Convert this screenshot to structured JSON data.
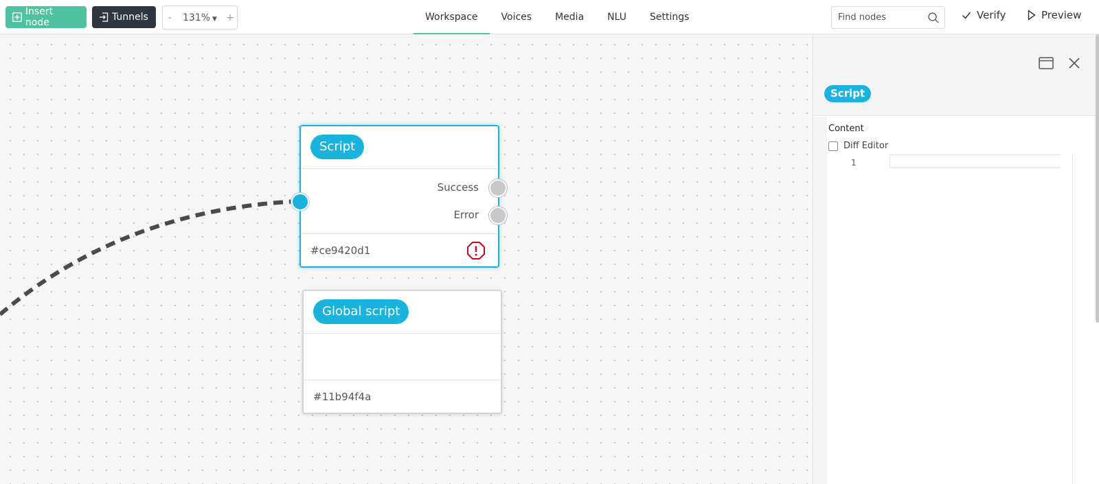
{
  "toolbar": {
    "insert_node_label": "Insert node",
    "tunnels_label": "Tunnels",
    "zoom": {
      "minus": "-",
      "value": "131%",
      "plus": "+"
    }
  },
  "nav": {
    "tabs": [
      {
        "label": "Workspace",
        "active": true
      },
      {
        "label": "Voices"
      },
      {
        "label": "Media"
      },
      {
        "label": "NLU"
      },
      {
        "label": "Settings"
      }
    ]
  },
  "search": {
    "placeholder": "Find nodes",
    "value": ""
  },
  "actions": {
    "verify_label": "Verify",
    "preview_label": "Preview"
  },
  "canvas": {
    "nodes": [
      {
        "title": "Script",
        "outputs": [
          "Success",
          "Error"
        ],
        "id_label": "#ce9420d1",
        "has_warning": true,
        "selected": true
      },
      {
        "title": "Global script",
        "outputs": [],
        "id_label": "#11b94f4a",
        "has_warning": false,
        "selected": false
      }
    ]
  },
  "panel": {
    "node_type": "Script",
    "content_label": "Content",
    "diff_editor_label": "Diff Editor",
    "diff_editor_checked": false,
    "editor_line_number": "1",
    "editor_code": ""
  },
  "colors": {
    "accent_green": "#4fc3a1",
    "accent_blue": "#1ab3dd",
    "dark_button": "#2f3640",
    "warning_red": "#d0021b"
  },
  "icons": {
    "insert": "plus-square-icon",
    "tunnels": "tunnel-enter-icon",
    "search": "search-icon",
    "verify": "check-icon",
    "preview": "play-outline-icon",
    "warning": "octagon-exclamation-icon",
    "window": "window-icon",
    "close": "close-icon"
  }
}
